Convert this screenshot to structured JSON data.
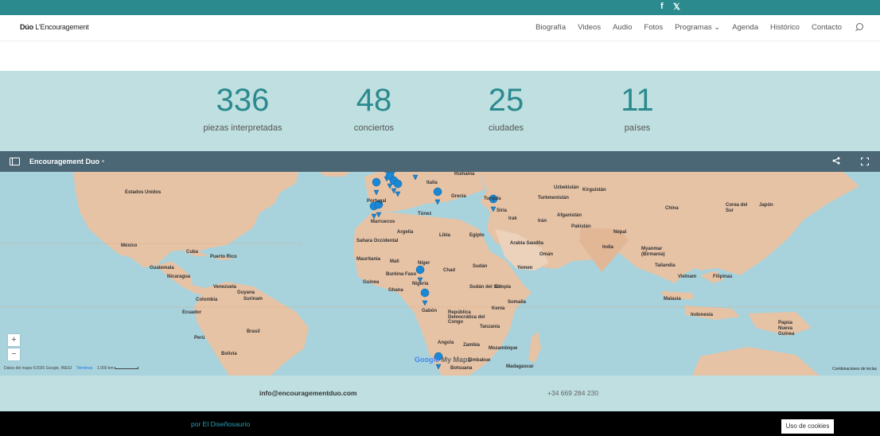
{
  "topbar": {
    "facebook_icon": "f",
    "x_icon": "𝕏"
  },
  "header": {
    "logo_part1": "Dúo",
    "logo_part2": "L'Encouragement",
    "nav": [
      "Biografía",
      "Videos",
      "Audio",
      "Fotos",
      "Programas",
      "Agenda",
      "Histórico",
      "Contacto"
    ],
    "dropdown_caret": "⌄"
  },
  "stats": [
    {
      "value": "336",
      "label": "piezas interpretadas"
    },
    {
      "value": "48",
      "label": "conciertos"
    },
    {
      "value": "25",
      "label": "ciudades"
    },
    {
      "value": "11",
      "label": "países"
    }
  ],
  "map": {
    "title": "Encouragement Duo",
    "share_icon": "<",
    "zoom_in": "+",
    "zoom_out": "−",
    "labels": {
      "estados_unidos": "Estados Unidos",
      "mexico": "México",
      "cuba": "Cuba",
      "puerto_rico": "Puerto Rico",
      "guatemala": "Guatemala",
      "nicaragua": "Nicaragua",
      "venezuela": "Venezuela",
      "guyana": "Guyana",
      "surinam": "Surinam",
      "colombia": "Colombia",
      "ecuador": "Ecuador",
      "peru": "Perú",
      "brasil": "Brasil",
      "bolivia": "Bolivia",
      "portugal": "Portugal",
      "marruecos": "Marruecos",
      "sahara_occidental": "Sahara Occidental",
      "mauritania": "Mauritania",
      "mali": "Mali",
      "niger": "Níger",
      "chad": "Chad",
      "burkina_faso": "Burkina Faso",
      "guinea": "Guinea",
      "ghana": "Ghana",
      "nigeria": "Nigeria",
      "argelia": "Argelia",
      "libia": "Libia",
      "egipto": "Egipto",
      "tunez": "Túnez",
      "italia": "Italia",
      "grecia": "Grecia",
      "rumania": "Rumania",
      "turquia": "Turquía",
      "siria": "Siria",
      "irak": "Irak",
      "iran": "Irán",
      "arabia_saudita": "Arabia Saudita",
      "oman": "Omán",
      "yemen": "Yemen",
      "sudan": "Sudán",
      "sudan_del_sur": "Sudán del Sur",
      "etiopia": "Etiopía",
      "somalia": "Somalia",
      "kenia": "Kenia",
      "tanzania": "Tanzania",
      "gabon": "Gabón",
      "rep_congo": "República Democrática del Congo",
      "angola": "Angola",
      "zambia": "Zambia",
      "zimbabue": "Zimbabue",
      "mozambique": "Mozambique",
      "botsuana": "Botsuana",
      "madagascar": "Madagascar",
      "turkmenistan": "Turkmenistán",
      "uzbekistan": "Uzbekistán",
      "kirguistan": "Kirguistán",
      "afganistan": "Afganistán",
      "pakistan": "Pakistán",
      "nepal": "Nepal",
      "india": "India",
      "china": "China",
      "corea_del_sur": "Corea del Sur",
      "japon": "Japón",
      "myanmar": "Myanmar (Birmania)",
      "tailandia": "Tailandia",
      "vietnam": "Vietnam",
      "filipinas": "Filipinas",
      "malasia": "Malasia",
      "indonesia": "Indonesia",
      "papua": "Papúa Nueva Guinea"
    },
    "attribution": "Datos del mapa ©2025 Google, INEGI",
    "terms": "Términos",
    "scale": "1.000 km",
    "google_text": "Google",
    "mymaps": "My Maps",
    "shortcuts": "Combinaciones de teclas"
  },
  "contact": {
    "email": "info@encouragementduo.com",
    "phone": "+34 669 284 230"
  },
  "footer": {
    "credit": "por El Diseñosaurio",
    "cookies_button": "Uso de cookies"
  },
  "colors": {
    "teal": "#2b8a8e",
    "stats_bg": "#bfdfe0",
    "mapbar_bg": "#4b6675",
    "land": "#e7c3a6",
    "water": "#a8d2dc",
    "marker": "#1a88d6"
  }
}
